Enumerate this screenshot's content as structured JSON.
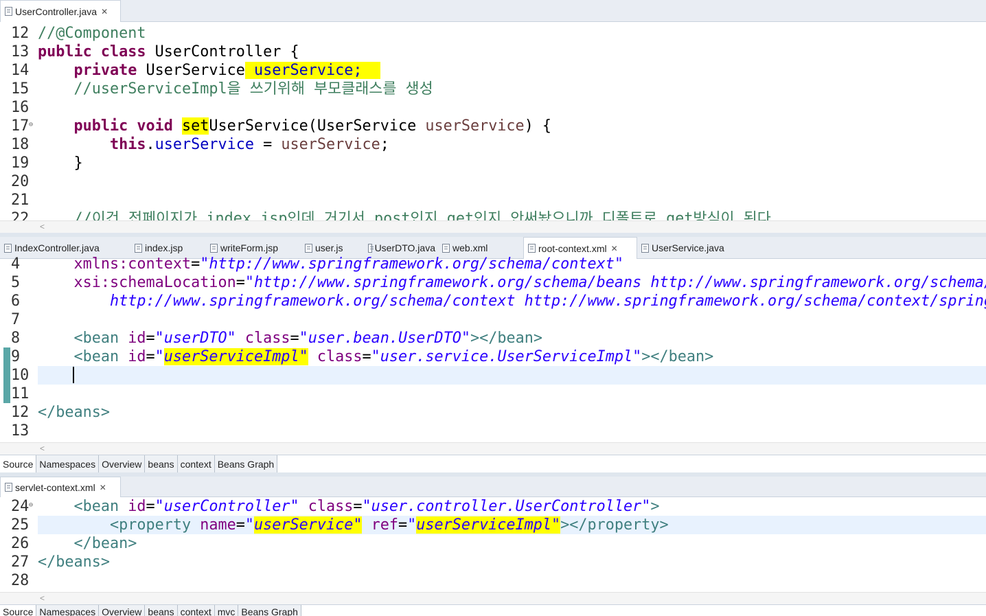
{
  "editor1": {
    "tab": "UserController.java",
    "lines": [
      {
        "n": "12",
        "parts": [
          [
            "cm",
            "//@Component"
          ]
        ]
      },
      {
        "n": "13",
        "parts": [
          [
            "kw",
            "public"
          ],
          [
            "",
            " "
          ],
          [
            "kw",
            "class"
          ],
          [
            "",
            " UserController {"
          ]
        ]
      },
      {
        "n": "14",
        "parts": [
          [
            "",
            "    "
          ],
          [
            "kw",
            "private"
          ],
          [
            "",
            " UserService"
          ],
          [
            "hl fld",
            " userService;  "
          ]
        ]
      },
      {
        "n": "15",
        "parts": [
          [
            "cm",
            "    //userServiceImpl을 쓰기위해 부모클래스를 생성"
          ]
        ]
      },
      {
        "n": "16",
        "parts": []
      },
      {
        "n": "17",
        "parts": [
          [
            "",
            "    "
          ],
          [
            "kw",
            "public"
          ],
          [
            "",
            " "
          ],
          [
            "kw",
            "void"
          ],
          [
            "",
            " "
          ],
          [
            "hl",
            "set"
          ],
          [
            "",
            "UserService(UserService "
          ],
          [
            "param",
            "userService"
          ],
          [
            "",
            ") {"
          ]
        ]
      },
      {
        "n": "18",
        "parts": [
          [
            "",
            "        "
          ],
          [
            "kw",
            "this"
          ],
          [
            "",
            "."
          ],
          [
            "fld",
            "userService"
          ],
          [
            "",
            " = "
          ],
          [
            "param",
            "userService"
          ],
          [
            "",
            ";"
          ]
        ]
      },
      {
        "n": "19",
        "parts": [
          [
            "",
            "    }"
          ]
        ]
      },
      {
        "n": "20",
        "parts": []
      },
      {
        "n": "21",
        "parts": []
      },
      {
        "n": "22",
        "parts": [
          [
            "cm",
            "    //이건 전페이지가 index.jsp인데 거기서 post인지 get인지 안써놨으니까 디폴트로 get방식이 된다"
          ]
        ]
      }
    ]
  },
  "editor2": {
    "tabs": [
      "IndexController.java",
      "index.jsp",
      "writeForm.jsp",
      "user.js",
      "UserDTO.java",
      "web.xml",
      "root-context.xml",
      "UserService.java"
    ],
    "active_tab": "root-context.xml",
    "lines": [
      {
        "n": "4",
        "parts": [
          [
            "",
            "    "
          ],
          [
            "attr",
            "xmlns:context"
          ],
          [
            "",
            "="
          ],
          [
            "val",
            "\"http://www.springframework.org/schema/context\""
          ]
        ]
      },
      {
        "n": "5",
        "parts": [
          [
            "",
            "    "
          ],
          [
            "attr",
            "xsi:schemaLocation"
          ],
          [
            "",
            "="
          ],
          [
            "val",
            "\"http://www.springframework.org/schema/beans http://www.springframework.org/schema/beans/spring-beans.xsd"
          ]
        ]
      },
      {
        "n": "6",
        "parts": [
          [
            "val",
            "        http://www.springframework.org/schema/context http://www.springframework.org/schema/context/spring-context.xsd\">"
          ]
        ]
      },
      {
        "n": "7",
        "parts": []
      },
      {
        "n": "8",
        "parts": [
          [
            "",
            "    "
          ],
          [
            "tag",
            "<bean"
          ],
          [
            "",
            " "
          ],
          [
            "attr",
            "id"
          ],
          [
            "",
            "="
          ],
          [
            "val",
            "\"userDTO\""
          ],
          [
            "",
            " "
          ],
          [
            "attr",
            "class"
          ],
          [
            "",
            "="
          ],
          [
            "val",
            "\"user.bean.UserDTO\""
          ],
          [
            "tag",
            "></bean>"
          ]
        ]
      },
      {
        "n": "9",
        "parts": [
          [
            "",
            "    "
          ],
          [
            "tag",
            "<bean"
          ],
          [
            "",
            " "
          ],
          [
            "attr",
            "id"
          ],
          [
            "",
            "="
          ],
          [
            "val",
            "\""
          ],
          [
            "val hl",
            "userServiceImpl\""
          ],
          [
            "",
            " "
          ],
          [
            "attr",
            "class"
          ],
          [
            "",
            "="
          ],
          [
            "val",
            "\"user.service.UserServiceImpl\""
          ],
          [
            "tag",
            "></bean>"
          ]
        ]
      },
      {
        "n": "10",
        "parts": []
      },
      {
        "n": "11",
        "parts": []
      },
      {
        "n": "12",
        "parts": [
          [
            "tag",
            "</beans>"
          ]
        ]
      },
      {
        "n": "13",
        "parts": []
      }
    ],
    "bottom_tabs": [
      "Source",
      "Namespaces",
      "Overview",
      "beans",
      "context",
      "Beans Graph"
    ]
  },
  "editor3": {
    "tab": "servlet-context.xml",
    "lines": [
      {
        "n": "24",
        "parts": [
          [
            "",
            "    "
          ],
          [
            "tag",
            "<bean"
          ],
          [
            "",
            " "
          ],
          [
            "attr",
            "id"
          ],
          [
            "",
            "="
          ],
          [
            "val",
            "\"userController\""
          ],
          [
            "",
            " "
          ],
          [
            "attr",
            "class"
          ],
          [
            "",
            "="
          ],
          [
            "val",
            "\"user.controller.UserController\""
          ],
          [
            "tag",
            ">"
          ]
        ]
      },
      {
        "n": "25",
        "parts": [
          [
            "",
            "        "
          ],
          [
            "tag",
            "<property"
          ],
          [
            "",
            " "
          ],
          [
            "attr",
            "name"
          ],
          [
            "",
            "="
          ],
          [
            "val",
            "\""
          ],
          [
            "val hl",
            "userService\""
          ],
          [
            "",
            " "
          ],
          [
            "attr",
            "ref"
          ],
          [
            "",
            "="
          ],
          [
            "val",
            "\""
          ],
          [
            "val hl",
            "userServiceImpl\""
          ],
          [
            "tag",
            "></property>"
          ]
        ]
      },
      {
        "n": "26",
        "parts": [
          [
            "",
            "    "
          ],
          [
            "tag",
            "</bean>"
          ]
        ]
      },
      {
        "n": "27",
        "parts": [
          [
            "tag",
            "</beans>"
          ]
        ]
      },
      {
        "n": "28",
        "parts": []
      }
    ],
    "bottom_tabs": [
      "Source",
      "Namespaces",
      "Overview",
      "beans",
      "context",
      "mvc",
      "Beans Graph"
    ]
  }
}
